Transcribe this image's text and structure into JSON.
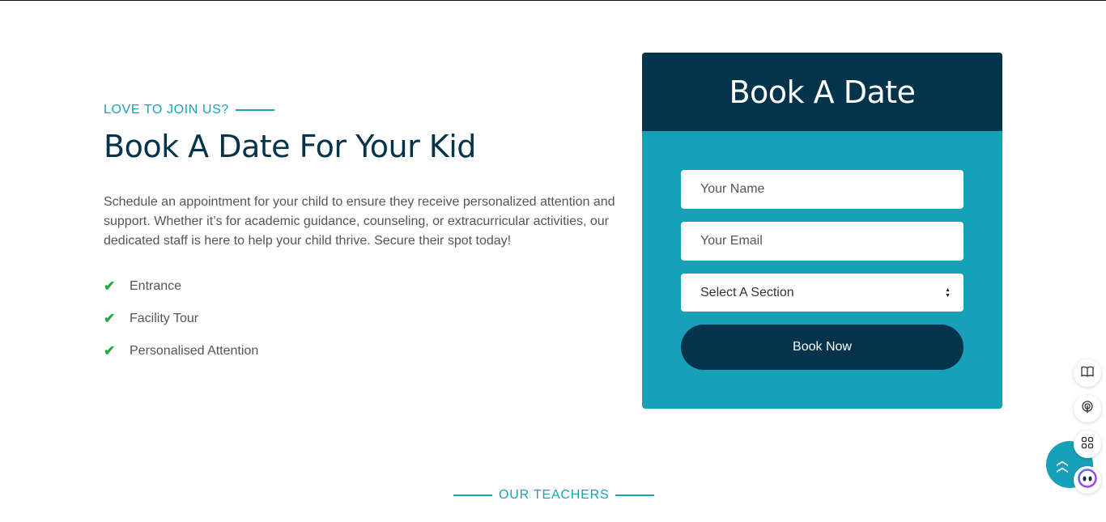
{
  "left": {
    "eyebrow": "LOVE TO JOIN US?",
    "headline": "Book A Date For Your Kid",
    "intro": "Schedule an appointment for your child to ensure they receive personalized attention and support. Whether it’s for academic guidance, counseling, or extracurricular activities, our dedicated staff is here to help your child thrive. Secure their spot today!",
    "features": [
      "Entrance",
      "Facility Tour",
      "Personalised Attention"
    ]
  },
  "form": {
    "title": "Book A Date",
    "name_placeholder": "Your Name",
    "email_placeholder": "Your Email",
    "section_selected": "Select A Section",
    "submit_label": "Book Now"
  },
  "teachers": {
    "eyebrow": "OUR TEACHERS"
  },
  "icons": {
    "check": "check-icon",
    "side": [
      "book-icon",
      "podcast-icon",
      "apps-grid-icon",
      "assistant-face-icon"
    ],
    "scroll_top": "double-chevron-up-icon"
  },
  "colors": {
    "navy": "#04344b",
    "teal": "#17a1b8",
    "check_green": "#28a745"
  }
}
